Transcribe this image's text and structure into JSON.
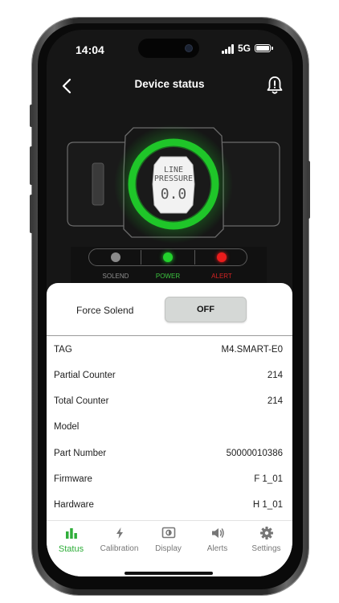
{
  "status_bar": {
    "time": "14:04",
    "network": "5G"
  },
  "header": {
    "title": "Device status"
  },
  "display": {
    "line1": "LINE",
    "line2": "PRESSURE",
    "value": "0.0"
  },
  "indicators": [
    {
      "label": "SOLEND",
      "color": "#8a8a8a",
      "label_color": "#8f8f8f"
    },
    {
      "label": "POWER",
      "color": "#22d12c",
      "label_color": "#3cc43f"
    },
    {
      "label": "ALERT",
      "color": "#ea1c1c",
      "label_color": "#d42323"
    }
  ],
  "force": {
    "label": "Force Solend",
    "button": "OFF"
  },
  "info": [
    {
      "label": "TAG",
      "value": "M4.SMART-E0"
    },
    {
      "label": "Partial Counter",
      "value": "214"
    },
    {
      "label": "Total Counter",
      "value": "214"
    },
    {
      "label": "Model",
      "value": ""
    },
    {
      "label": "Part Number",
      "value": "50000010386"
    },
    {
      "label": "Firmware",
      "value": "F 1_01"
    },
    {
      "label": "Hardware",
      "value": "H 1_01"
    }
  ],
  "nav": [
    {
      "label": "Status",
      "icon": "bar-chart-icon",
      "active": true
    },
    {
      "label": "Calibration",
      "icon": "lightning-icon",
      "active": false
    },
    {
      "label": "Display",
      "icon": "display-icon",
      "active": false
    },
    {
      "label": "Alerts",
      "icon": "speaker-icon",
      "active": false
    },
    {
      "label": "Settings",
      "icon": "gear-icon",
      "active": false
    }
  ],
  "colors": {
    "accent": "#2fae3a",
    "glow": "#22d12c"
  }
}
